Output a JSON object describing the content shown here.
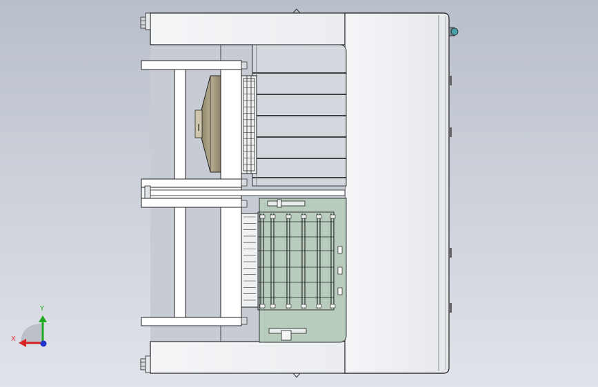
{
  "viewport": {
    "background_top": "#b9bfca",
    "background_bottom": "#e0e3ea"
  },
  "model": {
    "frame_fill": "#ffffff",
    "line_color": "#1e1e1e",
    "cone_fill": "#a59c80",
    "glass_fill": "#b7cdbf",
    "rail_fill": "#d6d9de",
    "bolt_fill": "#c8ccd1"
  },
  "triad": {
    "x_label": "X",
    "y_label": "Y",
    "x_color": "#d82424",
    "y_color": "#22aa22",
    "z_color": "#2233cc",
    "label_color": "#e03030"
  }
}
